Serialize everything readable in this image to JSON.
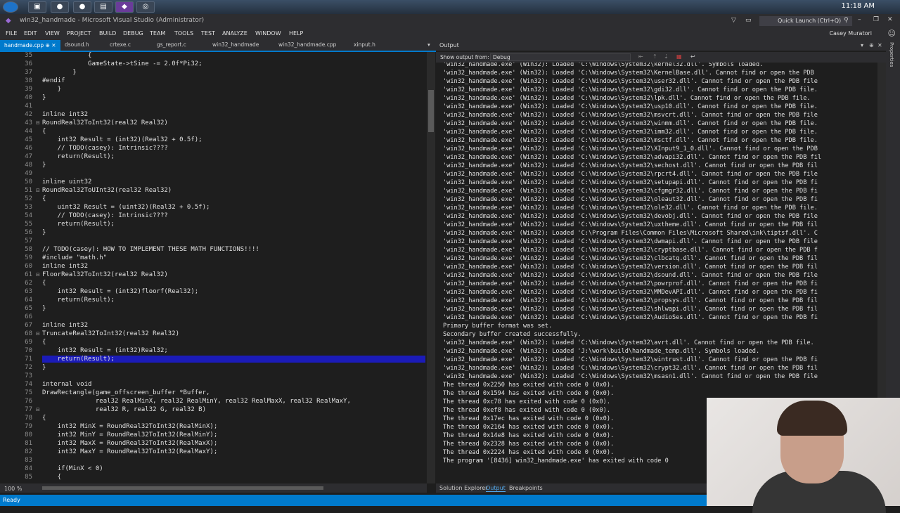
{
  "taskbar": {
    "clock": "11:18 AM"
  },
  "window": {
    "title": "win32_handmade - Microsoft Visual Studio (Administrator)",
    "quick_launch": "Quick Launch (Ctrl+Q)",
    "user": "Casey Muratori"
  },
  "menu": [
    "FILE",
    "EDIT",
    "VIEW",
    "PROJECT",
    "BUILD",
    "DEBUG",
    "TEAM",
    "TOOLS",
    "TEST",
    "ANALYZE",
    "WINDOW",
    "HELP"
  ],
  "tabs": [
    "handmade.cpp",
    "dsound.h",
    "crtexe.c",
    "gs_report.c",
    "win32_handmade",
    "win32_handmade.cpp",
    "xinput.h"
  ],
  "editor": {
    "zoom": "100 %",
    "lines": [
      {
        "n": "35",
        "t": "            {"
      },
      {
        "n": "36",
        "t": "            GameState->tSine -= 2.0f*Pi32;"
      },
      {
        "n": "37",
        "t": "        }"
      },
      {
        "n": "38",
        "t": "#endif"
      },
      {
        "n": "39",
        "t": "    }"
      },
      {
        "n": "40",
        "t": "}"
      },
      {
        "n": "41",
        "t": ""
      },
      {
        "n": "42",
        "t": "inline int32"
      },
      {
        "n": "43",
        "t": "RoundReal32ToInt32(real32 Real32)"
      },
      {
        "n": "44",
        "t": "{"
      },
      {
        "n": "45",
        "t": "    int32 Result = (int32)(Real32 + 0.5f);"
      },
      {
        "n": "46",
        "t": "    // TODO(casey): Intrinsic????"
      },
      {
        "n": "47",
        "t": "    return(Result);"
      },
      {
        "n": "48",
        "t": "}"
      },
      {
        "n": "49",
        "t": ""
      },
      {
        "n": "50",
        "t": "inline uint32"
      },
      {
        "n": "51",
        "t": "RoundReal32ToUInt32(real32 Real32)"
      },
      {
        "n": "52",
        "t": "{"
      },
      {
        "n": "53",
        "t": "    uint32 Result = (uint32)(Real32 + 0.5f);"
      },
      {
        "n": "54",
        "t": "    // TODO(casey): Intrinsic????"
      },
      {
        "n": "55",
        "t": "    return(Result);"
      },
      {
        "n": "56",
        "t": "}"
      },
      {
        "n": "57",
        "t": ""
      },
      {
        "n": "58",
        "t": "// TODO(casey): HOW TO IMPLEMENT THESE MATH FUNCTIONS!!!!"
      },
      {
        "n": "59",
        "t": "#include \"math.h\""
      },
      {
        "n": "60",
        "t": "inline int32"
      },
      {
        "n": "61",
        "t": "FloorReal32ToInt32(real32 Real32)"
      },
      {
        "n": "62",
        "t": "{"
      },
      {
        "n": "63",
        "t": "    int32 Result = (int32)floorf(Real32);"
      },
      {
        "n": "64",
        "t": "    return(Result);"
      },
      {
        "n": "65",
        "t": "}"
      },
      {
        "n": "66",
        "t": ""
      },
      {
        "n": "67",
        "t": "inline int32"
      },
      {
        "n": "68",
        "t": "TruncateReal32ToInt32(real32 Real32)"
      },
      {
        "n": "69",
        "t": "{"
      },
      {
        "n": "70",
        "t": "    int32 Result = (int32)Real32;"
      },
      {
        "n": "71",
        "t": "    return(Result);"
      },
      {
        "n": "72",
        "t": "}"
      },
      {
        "n": "73",
        "t": ""
      },
      {
        "n": "74",
        "t": "internal void"
      },
      {
        "n": "75",
        "t": "DrawRectangle(game_offscreen_buffer *Buffer,"
      },
      {
        "n": "76",
        "t": "              real32 RealMinX, real32 RealMinY, real32 RealMaxX, real32 RealMaxY,"
      },
      {
        "n": "77",
        "t": "              real32 R, real32 G, real32 B)"
      },
      {
        "n": "78",
        "t": "{"
      },
      {
        "n": "79",
        "t": "    int32 MinX = RoundReal32ToInt32(RealMinX);"
      },
      {
        "n": "80",
        "t": "    int32 MinY = RoundReal32ToInt32(RealMinY);"
      },
      {
        "n": "81",
        "t": "    int32 MaxX = RoundReal32ToInt32(RealMaxX);"
      },
      {
        "n": "82",
        "t": "    int32 MaxY = RoundReal32ToInt32(RealMaxY);"
      },
      {
        "n": "83",
        "t": ""
      },
      {
        "n": "84",
        "t": "    if(MinX < 0)"
      },
      {
        "n": "85",
        "t": "    {"
      }
    ]
  },
  "output": {
    "title": "Output",
    "show_from_label": "Show output from:",
    "show_from_value": "Debug",
    "lines": [
      "'win32_handmade.exe' (Win32): Loaded 'C:\\Windows\\System32\\kernel32.dll'. Symbols loaded.",
      "'win32_handmade.exe' (Win32): Loaded 'C:\\Windows\\System32\\KernelBase.dll'. Cannot find or open the PDB",
      "'win32_handmade.exe' (Win32): Loaded 'C:\\Windows\\System32\\user32.dll'. Cannot find or open the PDB file",
      "'win32_handmade.exe' (Win32): Loaded 'C:\\Windows\\System32\\gdi32.dll'. Cannot find or open the PDB file.",
      "'win32_handmade.exe' (Win32): Loaded 'C:\\Windows\\System32\\lpk.dll'. Cannot find or open the PDB file.",
      "'win32_handmade.exe' (Win32): Loaded 'C:\\Windows\\System32\\usp10.dll'. Cannot find or open the PDB file.",
      "'win32_handmade.exe' (Win32): Loaded 'C:\\Windows\\System32\\msvcrt.dll'. Cannot find or open the PDB file",
      "'win32_handmade.exe' (Win32): Loaded 'C:\\Windows\\System32\\winmm.dll'. Cannot find or open the PDB file.",
      "'win32_handmade.exe' (Win32): Loaded 'C:\\Windows\\System32\\imm32.dll'. Cannot find or open the PDB file.",
      "'win32_handmade.exe' (Win32): Loaded 'C:\\Windows\\System32\\msctf.dll'. Cannot find or open the PDB file.",
      "'win32_handmade.exe' (Win32): Loaded 'C:\\Windows\\System32\\XInput9_1_0.dll'. Cannot find or open the PDB",
      "'win32_handmade.exe' (Win32): Loaded 'C:\\Windows\\System32\\advapi32.dll'. Cannot find or open the PDB fil",
      "'win32_handmade.exe' (Win32): Loaded 'C:\\Windows\\System32\\sechost.dll'. Cannot find or open the PDB fil",
      "'win32_handmade.exe' (Win32): Loaded 'C:\\Windows\\System32\\rpcrt4.dll'. Cannot find or open the PDB file",
      "'win32_handmade.exe' (Win32): Loaded 'C:\\Windows\\System32\\setupapi.dll'. Cannot find or open the PDB fi",
      "'win32_handmade.exe' (Win32): Loaded 'C:\\Windows\\System32\\cfgmgr32.dll'. Cannot find or open the PDB fi",
      "'win32_handmade.exe' (Win32): Loaded 'C:\\Windows\\System32\\oleaut32.dll'. Cannot find or open the PDB fi",
      "'win32_handmade.exe' (Win32): Loaded 'C:\\Windows\\System32\\ole32.dll'. Cannot find or open the PDB file.",
      "'win32_handmade.exe' (Win32): Loaded 'C:\\Windows\\System32\\devobj.dll'. Cannot find or open the PDB file",
      "'win32_handmade.exe' (Win32): Loaded 'C:\\Windows\\System32\\uxtheme.dll'. Cannot find or open the PDB fil",
      "'win32_handmade.exe' (Win32): Loaded 'C:\\Program Files\\Common Files\\Microsoft Shared\\ink\\tiptsf.dll'. C",
      "'win32_handmade.exe' (Win32): Loaded 'C:\\Windows\\System32\\dwmapi.dll'. Cannot find or open the PDB file",
      "'win32_handmade.exe' (Win32): Loaded 'C:\\Windows\\System32\\cryptbase.dll'. Cannot find or open the PDB f",
      "'win32_handmade.exe' (Win32): Loaded 'C:\\Windows\\System32\\clbcatq.dll'. Cannot find or open the PDB fil",
      "'win32_handmade.exe' (Win32): Loaded 'C:\\Windows\\System32\\version.dll'. Cannot find or open the PDB fil",
      "'win32_handmade.exe' (Win32): Loaded 'C:\\Windows\\System32\\dsound.dll'. Cannot find or open the PDB file",
      "'win32_handmade.exe' (Win32): Loaded 'C:\\Windows\\System32\\powrprof.dll'. Cannot find or open the PDB fi",
      "'win32_handmade.exe' (Win32): Loaded 'C:\\Windows\\System32\\MMDevAPI.dll'. Cannot find or open the PDB fi",
      "'win32_handmade.exe' (Win32): Loaded 'C:\\Windows\\System32\\propsys.dll'. Cannot find or open the PDB fil",
      "'win32_handmade.exe' (Win32): Loaded 'C:\\Windows\\System32\\shlwapi.dll'. Cannot find or open the PDB fil",
      "'win32_handmade.exe' (Win32): Loaded 'C:\\Windows\\System32\\AudioSes.dll'. Cannot find or open the PDB fi",
      "Primary buffer format was set.",
      "Secondary buffer created successfully.",
      "'win32_handmade.exe' (Win32): Loaded 'C:\\Windows\\System32\\avrt.dll'. Cannot find or open the PDB file.",
      "'win32_handmade.exe' (Win32): Loaded 'J:\\work\\build\\handmade_temp.dll'. Symbols loaded.",
      "'win32_handmade.exe' (Win32): Loaded 'C:\\Windows\\System32\\wintrust.dll'. Cannot find or open the PDB fi",
      "'win32_handmade.exe' (Win32): Loaded 'C:\\Windows\\System32\\crypt32.dll'. Cannot find or open the PDB fil",
      "'win32_handmade.exe' (Win32): Loaded 'C:\\Windows\\System32\\msasn1.dll'. Cannot find or open the PDB file",
      "The thread 0x2250 has exited with code 0 (0x0).",
      "The thread 0x1594 has exited with code 0 (0x0).",
      "The thread 0xc78 has exited with code 0 (0x0).",
      "The thread 0xef8 has exited with code 0 (0x0).",
      "The thread 0x17ec has exited with code 0 (0x0).",
      "The thread 0x2164 has exited with code 0 (0x0).",
      "The thread 0x14e8 has exited with code 0 (0x0).",
      "The thread 0x2328 has exited with code 0 (0x0).",
      "The thread 0x2224 has exited with code 0 (0x0).",
      "The program '[8436] win32_handmade.exe' has exited with code 0"
    ]
  },
  "bottom_tabs": [
    "Solution Explorer",
    "Output",
    "Breakpoints"
  ],
  "sidebar_label": "Properties",
  "status": "Ready"
}
